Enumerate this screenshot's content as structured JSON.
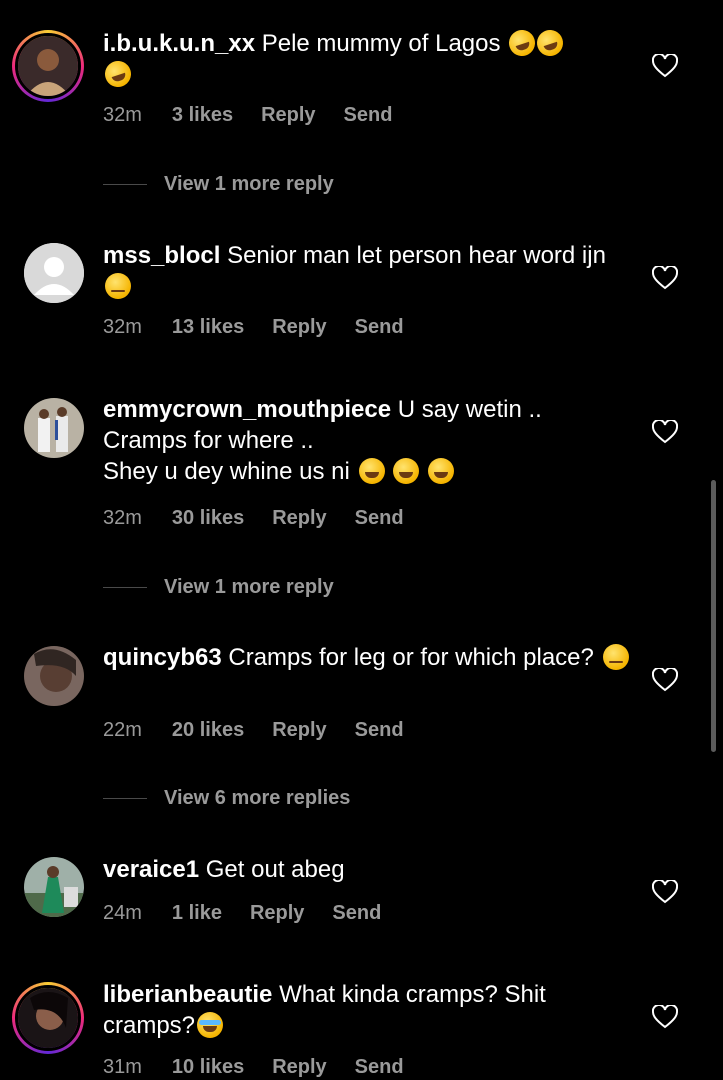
{
  "comments": [
    {
      "username": "i.b.u.k.u.n_xx",
      "text": "Pele mummy of Lagos",
      "emojis": [
        "rolling-laughing",
        "rolling-laughing",
        "rolling-laughing"
      ],
      "time": "32m",
      "likes": "3 likes",
      "reply": "Reply",
      "send": "Send",
      "more_replies": "View 1 more reply"
    },
    {
      "username": "mss_blocl",
      "text": "Senior man let person hear word ijn",
      "emojis": [
        "eye-roll"
      ],
      "time": "32m",
      "likes": "13 likes",
      "reply": "Reply",
      "send": "Send"
    },
    {
      "username": "emmycrown_mouthpiece",
      "text": "U say wetin ..\n Cramps for where ..\nShey u dey whine us ni",
      "emojis": [
        "tears-of-joy",
        "tears-of-joy",
        "tears-of-joy"
      ],
      "time": "32m",
      "likes": "30 likes",
      "reply": "Reply",
      "send": "Send",
      "more_replies": "View 1 more reply"
    },
    {
      "username": "quincyb63",
      "text": "Cramps for leg or for which place?",
      "emojis": [
        "raised-eyebrow"
      ],
      "time": "22m",
      "likes": "20 likes",
      "reply": "Reply",
      "send": "Send",
      "more_replies": "View 6 more replies"
    },
    {
      "username": "veraice1",
      "text": "Get out abeg",
      "emojis": [],
      "time": "24m",
      "likes": "1 like",
      "reply": "Reply",
      "send": "Send"
    },
    {
      "username": "liberianbeautie",
      "text": "What kinda cramps? Shit cramps?",
      "emojis": [
        "loudly-crying"
      ],
      "time": "31m",
      "likes": "10 likes",
      "reply": "Reply",
      "send": "Send"
    }
  ],
  "colors": {
    "background": "#000000",
    "text": "#ffffff",
    "meta": "#9a9a9a",
    "story_ring": "#ee2a7b"
  }
}
